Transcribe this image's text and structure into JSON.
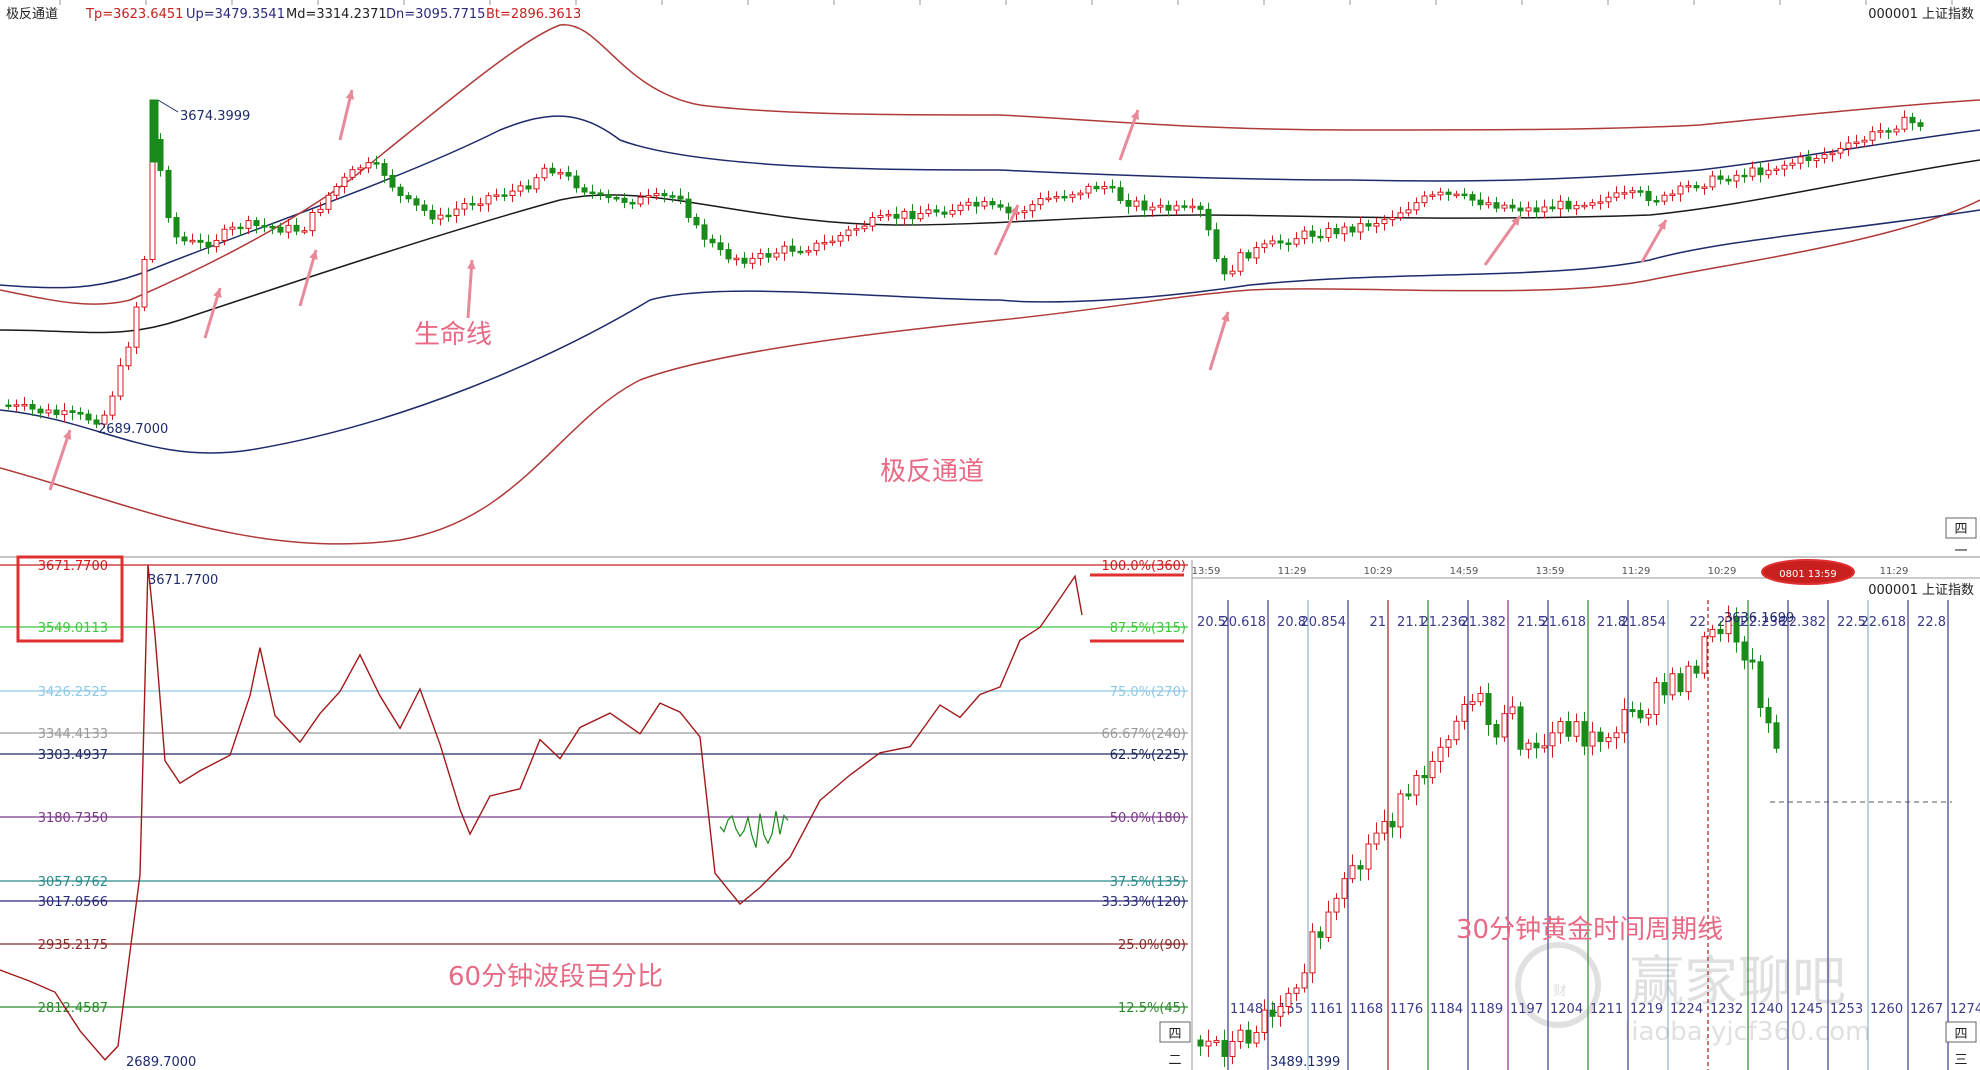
{
  "top_panel": {
    "title": "极反通道",
    "params": {
      "tp": "Tp=3623.6451",
      "up": "Up=3479.3541",
      "md": "Md=3314.2371",
      "dn": "Dn=3095.7715",
      "bt": "Bt=2896.3613"
    },
    "instrument": "000001  上证指数",
    "peak_label": "3674.3999",
    "low_label": "2689.7000",
    "annotations": [
      "生命线",
      "极反通道"
    ],
    "corner_marks": [
      "四",
      "一"
    ]
  },
  "bottom_left_panel": {
    "annotation": "60分钟波段百分比",
    "peak_label": "3671.7700",
    "low_label": "2689.7000",
    "levels": [
      {
        "price": "3671.7700",
        "pct": "100.0%(360)",
        "color": "#c8201e"
      },
      {
        "price": "3549.0113",
        "pct": "87.5%(315)",
        "color": "#3ec83e"
      },
      {
        "price": "3426.2525",
        "pct": "75.0%(270)",
        "color": "#8ecae6"
      },
      {
        "price": "3344.4133",
        "pct": "66.67%(240)",
        "color": "#9a9a9a"
      },
      {
        "price": "3303.4937",
        "pct": "62.5%(225)",
        "color": "#1e2a60"
      },
      {
        "price": "3180.7350",
        "pct": "50.0%(180)",
        "color": "#7a3a8a"
      },
      {
        "price": "3057.9762",
        "pct": "37.5%(135)",
        "color": "#2a8a8a"
      },
      {
        "price": "3017.0566",
        "pct": "33.33%(120)",
        "color": "#2a2a7a"
      },
      {
        "price": "2935.2175",
        "pct": "25.0%(90)",
        "color": "#8a2a2a"
      },
      {
        "price": "2812.4587",
        "pct": "12.5%(45)",
        "color": "#2a8a2a"
      }
    ],
    "corner_marks": [
      "四",
      "二"
    ]
  },
  "bottom_right_panel": {
    "annotation": "30分钟黄金时间周期线",
    "instrument": "000001  上证指数",
    "cursor_time": "0801 13:59",
    "time_axis": [
      "13:59",
      "11:29",
      "10:29",
      "14:59",
      "13:59",
      "11:29",
      "10:29",
      "13:59",
      "11:29"
    ],
    "cycle_labels_top": [
      "20.5",
      "20.618",
      "20.8",
      "20.854",
      "21",
      "21.1",
      "21.236",
      "21.382",
      "21.5",
      "21.618",
      "21.8",
      "21.854",
      "22",
      "22.1",
      "22.236",
      "22.382",
      "22.5",
      "22.618",
      "22.8"
    ],
    "cycle_labels_bottom": [
      "1148",
      "1155",
      "1161",
      "1168",
      "1176",
      "1184",
      "1189",
      "1197",
      "1204",
      "1211",
      "1219",
      "1224",
      "1232",
      "1240",
      "1245",
      "1253",
      "1260",
      "1267",
      "1274"
    ],
    "peak_label": "3636.1699",
    "low_label": "3489.1399",
    "watermark": "赢家聊吧",
    "watermark_url": "liaoba.yjcf360.com",
    "corner_marks": [
      "四",
      "三"
    ]
  },
  "chart_data": [
    {
      "type": "candlestick-channel",
      "title": "极反通道",
      "series": [
        {
          "name": "Tp",
          "last": 3623.6451
        },
        {
          "name": "Up",
          "last": 3479.3541
        },
        {
          "name": "Md",
          "last": 3314.2371
        },
        {
          "name": "Dn",
          "last": 3095.7715
        },
        {
          "name": "Bt",
          "last": 2896.3613
        }
      ],
      "high": 3674.3999,
      "low": 2689.7
    },
    {
      "type": "line",
      "title": "60分钟波段百分比",
      "high": 3671.77,
      "low": 2689.7,
      "levels_pct": [
        100.0,
        87.5,
        75.0,
        66.67,
        62.5,
        50.0,
        37.5,
        33.33,
        25.0,
        12.5
      ],
      "levels_price": [
        3671.77,
        3549.0113,
        3426.2525,
        3344.4133,
        3303.4937,
        3180.735,
        3057.9762,
        3017.0566,
        2935.2175,
        2812.4587
      ]
    },
    {
      "type": "candlestick",
      "title": "30分钟黄金时间周期线",
      "high": 3636.1699,
      "low": 3489.1399
    }
  ],
  "colors": {
    "tp_bt": "#b03a3a",
    "up_dn": "#1e2a6a",
    "md": "#1a1a1a",
    "up_candle": "#d01c1c",
    "down_candle": "#1a8a1a",
    "annotation": "#e86a85"
  }
}
